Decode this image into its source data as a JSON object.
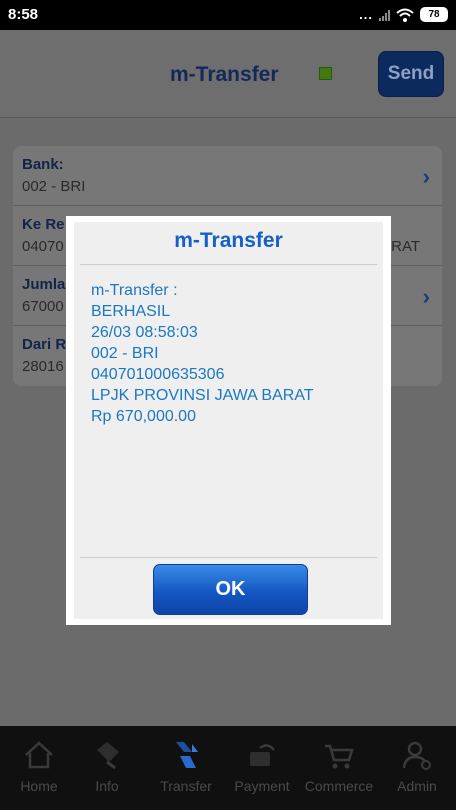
{
  "status_bar": {
    "time": "8:58",
    "dots": "...",
    "battery": "78"
  },
  "header": {
    "title": "m-Transfer",
    "send_label": "Send"
  },
  "form": {
    "rows": [
      {
        "label": "Bank:",
        "value": "002 - BRI"
      },
      {
        "label": "Ke Re",
        "value": "04070",
        "value_right": "RAT"
      },
      {
        "label": "Jumla",
        "value": "67000"
      },
      {
        "label": "Dari R",
        "value": "28016"
      }
    ]
  },
  "dialog": {
    "title": "m-Transfer",
    "lines": [
      "m-Transfer :",
      "BERHASIL",
      "26/03 08:58:03",
      "002 - BRI",
      "040701000635306",
      "LPJK PROVINSI JAWA BARAT",
      "Rp 670,000.00"
    ],
    "ok_label": "OK"
  },
  "nav": {
    "items": [
      {
        "label": "Home",
        "icon": "home-icon"
      },
      {
        "label": "Info",
        "icon": "info-icon"
      },
      {
        "label": "Transfer",
        "icon": "transfer-icon"
      },
      {
        "label": "Payment",
        "icon": "payment-icon"
      },
      {
        "label": "Commerce",
        "icon": "cart-icon"
      },
      {
        "label": "Admin",
        "icon": "admin-icon"
      }
    ]
  },
  "colors": {
    "title_blue": "#14285a",
    "dialog_title": "#1460c8",
    "message_text": "#1a78c2",
    "ok_button": "#1458c4",
    "status_indicator": "#3f7a12"
  }
}
